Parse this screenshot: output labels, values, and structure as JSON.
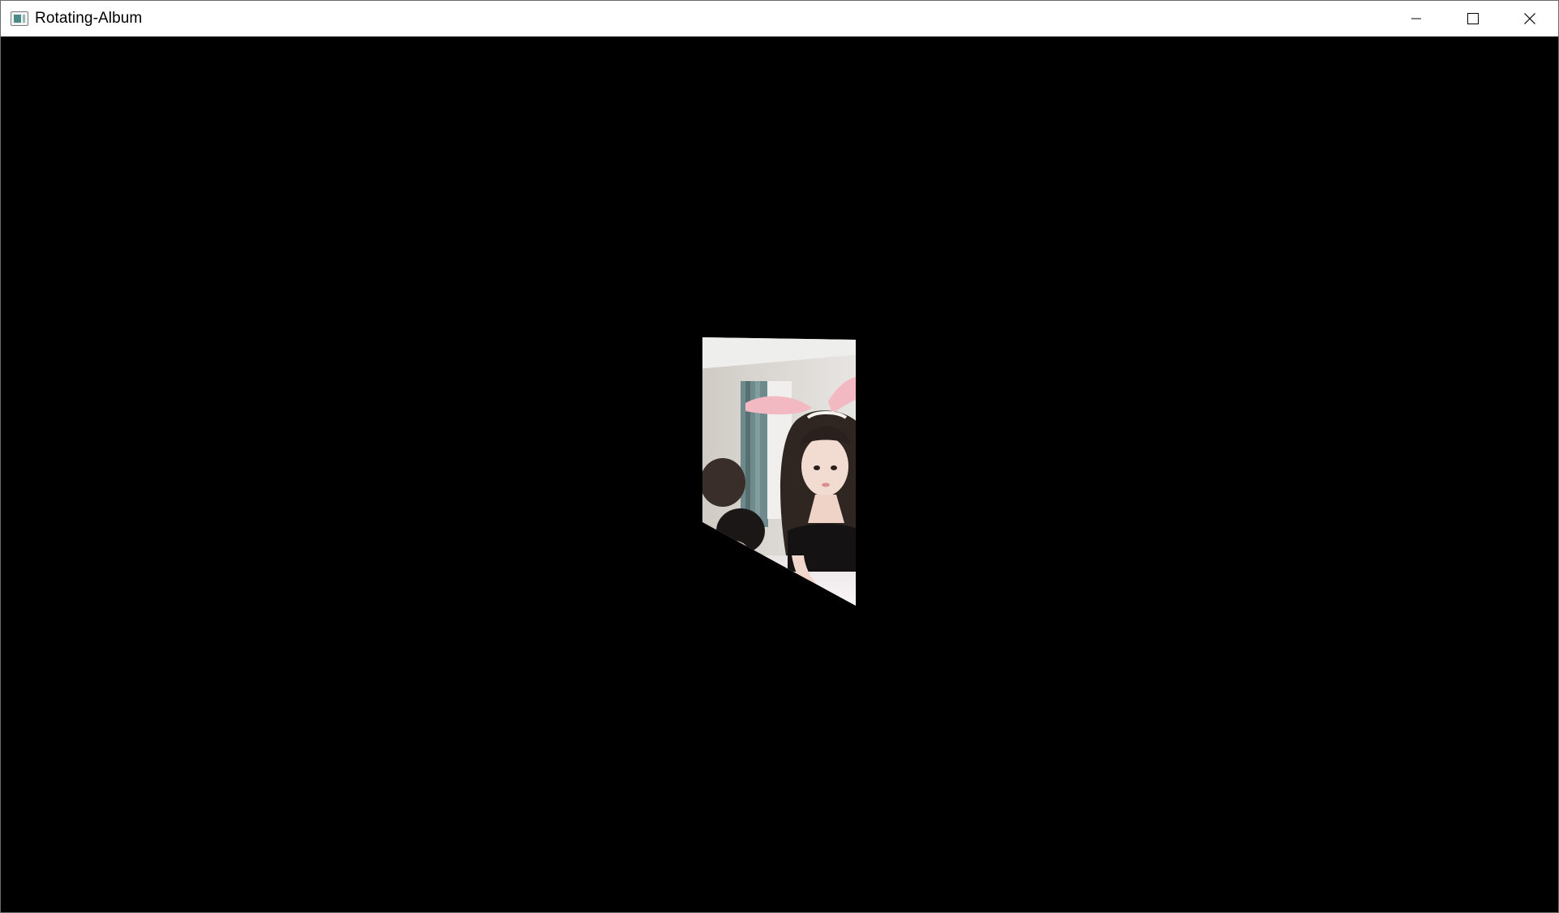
{
  "window": {
    "title": "Rotating-Album",
    "icon": "app-window-icon",
    "controls": [
      "minimize-icon",
      "maximize-icon",
      "close-icon"
    ]
  },
  "colors": {
    "titlebar_bg": "#ffffff",
    "canvas_bg": "#000000",
    "photo_wall": "#d6d3cf",
    "photo_hair": "#2f2622",
    "photo_skin": "#f0d6cb",
    "photo_ears": "#f2b9c2"
  },
  "album": {
    "photo": "rotating-photo-card"
  }
}
